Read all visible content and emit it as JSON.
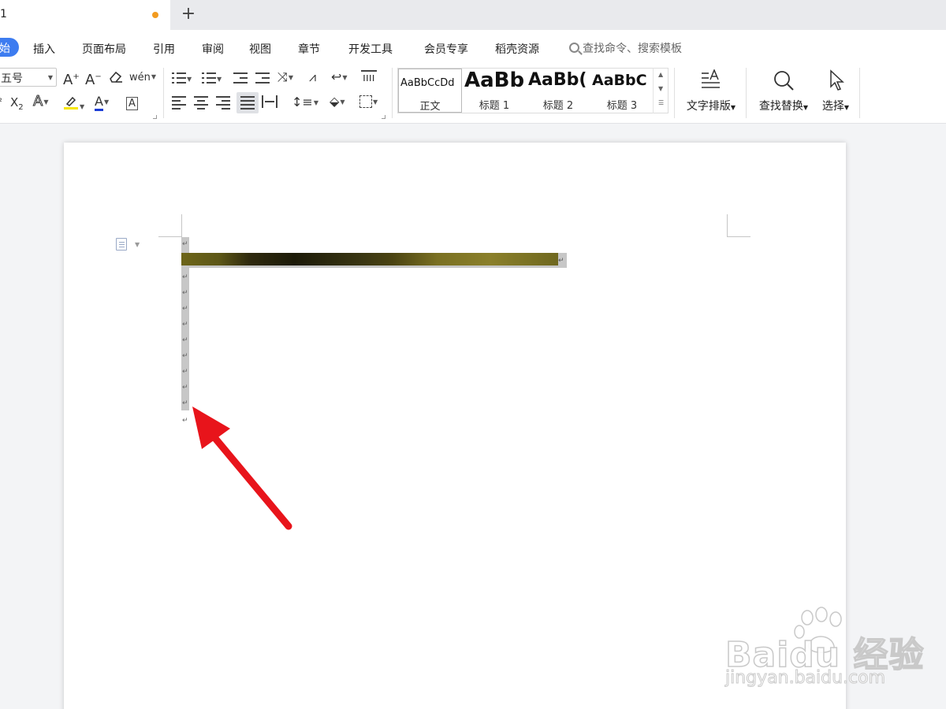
{
  "tab": {
    "title": "1",
    "new_tab": "+"
  },
  "menu": {
    "start": "始",
    "items": [
      "插入",
      "页面布局",
      "引用",
      "审阅",
      "视图",
      "章节",
      "开发工具",
      "会员专享",
      "稻壳资源"
    ],
    "search_placeholder": "查找命令、搜索模板"
  },
  "toolbar": {
    "font_size": "五号",
    "grow_font": "A",
    "shrink_font": "A",
    "pinyin": "wén",
    "subscript": "X",
    "font_color": "A",
    "char_border": "A",
    "styles": [
      {
        "sample": "AaBbCcDd",
        "name": "正文",
        "selected": true
      },
      {
        "sample": "AaBb",
        "name": "标题 1",
        "selected": false
      },
      {
        "sample": "AaBb(",
        "name": "标题 2",
        "selected": false
      },
      {
        "sample": "AaBbC",
        "name": "标题 3",
        "selected": false
      }
    ],
    "text_layout": "文字排版",
    "find_replace": "查找替换",
    "select": "选择"
  },
  "document": {
    "paragraph_mark": "↵",
    "image_selected": true
  },
  "watermark": {
    "brand": "Baidu 经验",
    "url": "jingyan.baidu.com"
  },
  "colors": {
    "accent": "#3d7cf0",
    "unsaved_dot": "#f29b20",
    "arrow": "#e8141b",
    "highlight": "#f7e600",
    "font_color": "#1a3cd6"
  }
}
